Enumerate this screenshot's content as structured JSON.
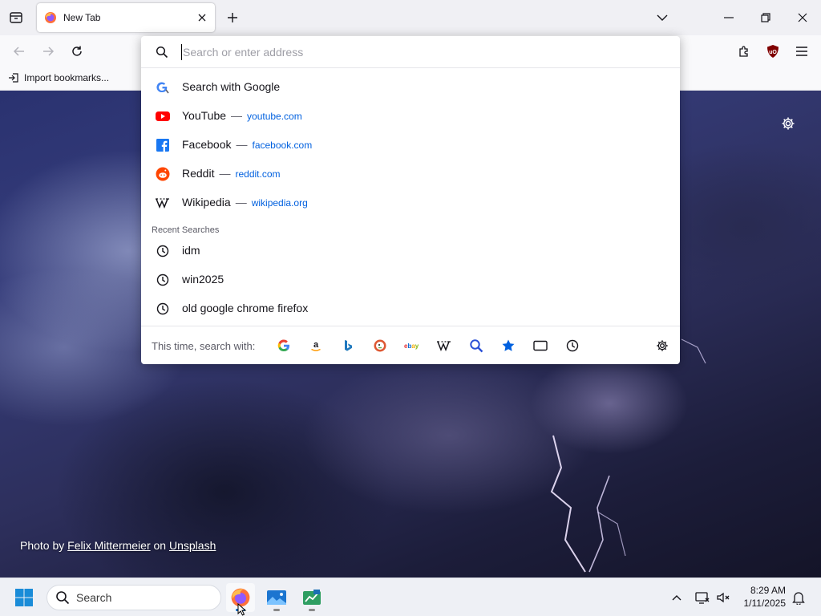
{
  "browser": {
    "tab": {
      "title": "New Tab"
    },
    "bookmarks": {
      "import_label": "Import bookmarks..."
    }
  },
  "urlbar": {
    "placeholder": "Search or enter address",
    "value": "",
    "suggestions": [
      {
        "label": "Search with Google",
        "url": "",
        "icon": "google-icon"
      },
      {
        "label": "YouTube",
        "url": "youtube.com",
        "icon": "youtube-icon"
      },
      {
        "label": "Facebook",
        "url": "facebook.com",
        "icon": "facebook-icon"
      },
      {
        "label": "Reddit",
        "url": "reddit.com",
        "icon": "reddit-icon"
      },
      {
        "label": "Wikipedia",
        "url": "wikipedia.org",
        "icon": "wikipedia-icon"
      }
    ],
    "separator": "—",
    "recent_title": "Recent Searches",
    "recent": [
      "idm",
      "win2025",
      "old google chrome firefox"
    ],
    "oneoff_label": "This time, search with:",
    "engines": [
      "google",
      "amazon",
      "bing",
      "duckduckgo",
      "ebay",
      "wikipedia",
      "search",
      "bookmarks",
      "tabs",
      "history"
    ]
  },
  "newtab": {
    "credit": {
      "prefix": "Photo by",
      "author": "Felix Mittermeier",
      "on": "on",
      "site": "Unsplash"
    }
  },
  "taskbar": {
    "search_label": "Search",
    "time": "8:29 AM",
    "date": "1/11/2025"
  },
  "colors": {
    "accent": "#0060df",
    "link": "#0060df",
    "youtube": "#ff0000",
    "facebook": "#1877f2",
    "reddit": "#ff4500"
  }
}
